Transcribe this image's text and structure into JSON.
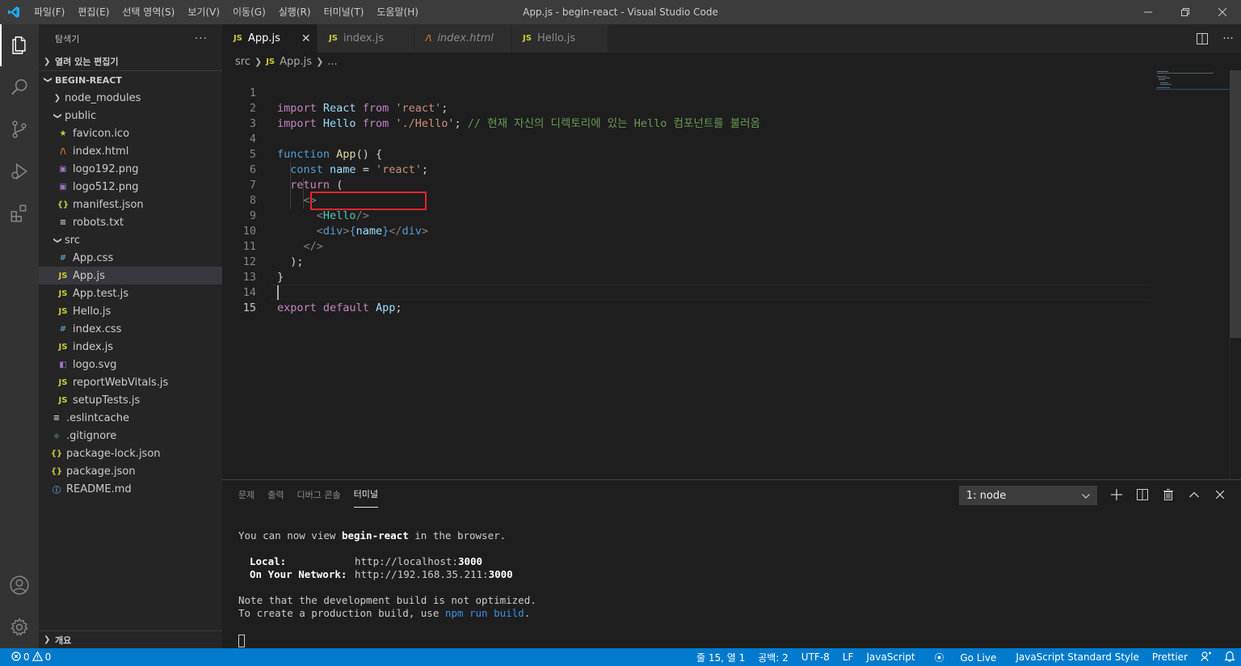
{
  "window": {
    "title": "App.js - begin-react - Visual Studio Code",
    "menu": [
      "파일(F)",
      "편집(E)",
      "선택 영역(S)",
      "보기(V)",
      "이동(G)",
      "실행(R)",
      "터미널(T)",
      "도움말(H)"
    ]
  },
  "sidebar": {
    "title": "탐색기",
    "open_editors": "열려 있는 편집기",
    "project": "BEGIN-REACT",
    "outline": "개요",
    "tree": [
      {
        "label": "node_modules",
        "type": "folder-collapsed",
        "depth": 1,
        "icon": "chevron-right"
      },
      {
        "label": "public",
        "type": "folder-open",
        "depth": 1,
        "icon": "chevron-down"
      },
      {
        "label": "favicon.ico",
        "type": "file",
        "depth": 2,
        "icon": "star-icon"
      },
      {
        "label": "index.html",
        "type": "file",
        "depth": 2,
        "icon": "html-icon"
      },
      {
        "label": "logo192.png",
        "type": "file",
        "depth": 2,
        "icon": "image-icon"
      },
      {
        "label": "logo512.png",
        "type": "file",
        "depth": 2,
        "icon": "image-icon"
      },
      {
        "label": "manifest.json",
        "type": "file",
        "depth": 2,
        "icon": "json-icon"
      },
      {
        "label": "robots.txt",
        "type": "file",
        "depth": 2,
        "icon": "text-icon"
      },
      {
        "label": "src",
        "type": "folder-open",
        "depth": 1,
        "icon": "chevron-down"
      },
      {
        "label": "App.css",
        "type": "file",
        "depth": 2,
        "icon": "css-icon"
      },
      {
        "label": "App.js",
        "type": "file",
        "depth": 2,
        "icon": "js-icon",
        "selected": true
      },
      {
        "label": "App.test.js",
        "type": "file",
        "depth": 2,
        "icon": "js-icon"
      },
      {
        "label": "Hello.js",
        "type": "file",
        "depth": 2,
        "icon": "js-icon"
      },
      {
        "label": "index.css",
        "type": "file",
        "depth": 2,
        "icon": "css-icon"
      },
      {
        "label": "index.js",
        "type": "file",
        "depth": 2,
        "icon": "js-icon"
      },
      {
        "label": "logo.svg",
        "type": "file",
        "depth": 2,
        "icon": "svg-icon"
      },
      {
        "label": "reportWebVitals.js",
        "type": "file",
        "depth": 2,
        "icon": "js-icon"
      },
      {
        "label": "setupTests.js",
        "type": "file",
        "depth": 2,
        "icon": "js-icon"
      },
      {
        "label": ".eslintcache",
        "type": "file",
        "depth": 1,
        "icon": "text-icon"
      },
      {
        "label": ".gitignore",
        "type": "file",
        "depth": 1,
        "icon": "git-icon"
      },
      {
        "label": "package-lock.json",
        "type": "file",
        "depth": 1,
        "icon": "json-icon"
      },
      {
        "label": "package.json",
        "type": "file",
        "depth": 1,
        "icon": "json-icon"
      },
      {
        "label": "README.md",
        "type": "file",
        "depth": 1,
        "icon": "info-icon"
      }
    ]
  },
  "tabs": [
    {
      "label": "App.js",
      "icon": "JS",
      "active": true
    },
    {
      "label": "index.js",
      "icon": "JS",
      "active": false
    },
    {
      "label": "index.html",
      "icon": "html",
      "active": false
    },
    {
      "label": "Hello.js",
      "icon": "JS",
      "active": false
    }
  ],
  "breadcrumb": {
    "folder": "src",
    "file": "App.js",
    "tail": "..."
  },
  "editor": {
    "current_line": 15,
    "lines": [
      {
        "n": "1"
      },
      {
        "n": "2"
      },
      {
        "n": "3"
      },
      {
        "n": "4"
      },
      {
        "n": "5"
      },
      {
        "n": "6"
      },
      {
        "n": "7"
      },
      {
        "n": "8"
      },
      {
        "n": "9"
      },
      {
        "n": "10"
      },
      {
        "n": "11"
      },
      {
        "n": "12"
      },
      {
        "n": "13"
      },
      {
        "n": "14"
      },
      {
        "n": "15"
      }
    ]
  },
  "panel": {
    "tabs": [
      "문제",
      "출력",
      "디버그 콘솔",
      "터미널"
    ],
    "active_tab": "터미널",
    "terminal_select": "1: node",
    "terminal": {
      "l1a": "You can now view ",
      "l1b": "begin-react",
      "l1c": " in the browser.",
      "local_label": "Local:",
      "local_url_a": "http://localhost:",
      "local_port": "3000",
      "net_label": "On Your Network:",
      "net_url_a": "http://192.168.35.211:",
      "net_port": "3000",
      "note1": "Note that the development build is not optimized.",
      "note2a": "To create a production build, use ",
      "note2b": "npm run build",
      "note2c": "."
    }
  },
  "status": {
    "errors": "0",
    "warnings": "0",
    "position": "줄 15, 열 1",
    "spaces": "공백: 2",
    "encoding": "UTF-8",
    "eol": "LF",
    "language": "JavaScript",
    "golive": "Go Live",
    "style": "JavaScript Standard Style",
    "prettier": "Prettier"
  },
  "colors": {
    "statusbar": "#007acc",
    "highlight_box": "#e8252f",
    "js_icon": "#cbcb41"
  }
}
